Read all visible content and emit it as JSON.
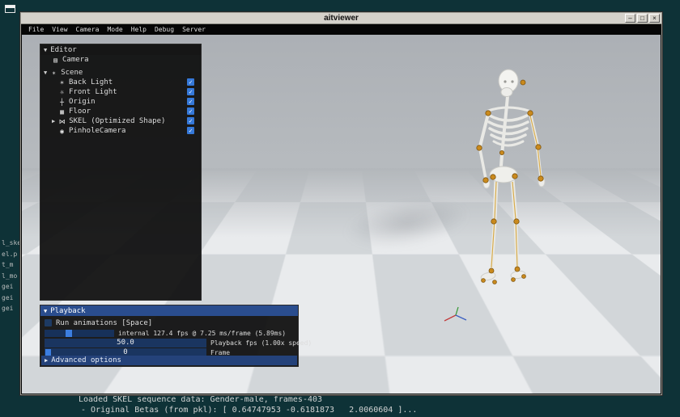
{
  "window": {
    "title": "aitviewer",
    "controls": {
      "minimize": "–",
      "maximize": "□",
      "close": "×"
    }
  },
  "menu": {
    "items": [
      "File",
      "View",
      "Camera",
      "Mode",
      "Help",
      "Debug",
      "Server"
    ]
  },
  "editor": {
    "arrow": "▼",
    "title": "Editor",
    "check_glyph": "✓",
    "items": [
      {
        "glyph": "▤",
        "label": "Camera"
      },
      {
        "arrow": "▼",
        "glyph": "∗",
        "label": "Scene"
      },
      {
        "glyph": "☀",
        "label": "Back Light",
        "checked": true
      },
      {
        "glyph": "☼",
        "label": "Front Light",
        "checked": true
      },
      {
        "glyph": "┼",
        "label": "Origin",
        "checked": true
      },
      {
        "glyph": "▦",
        "label": "Floor",
        "checked": true
      },
      {
        "arrow": "▶",
        "glyph": "⋈",
        "label": "SKEL (Optimized Shape)",
        "checked": true
      },
      {
        "glyph": "◉",
        "label": "PinholeCamera",
        "checked": true
      }
    ]
  },
  "playback": {
    "arrow": "▼",
    "title": "Playback",
    "run_label": "Run animations [Space]",
    "perf_text": "internal 127.4 fps @ 7.25 ms/frame (5.89ms)",
    "fps_value": "50.0",
    "fps_label": "Playback fps (1.00x speed)",
    "frame_value": "0",
    "frame_label": "Frame",
    "advanced_arrow": "▶",
    "advanced_label": "Advanced options"
  },
  "viewport": {
    "hint_glyph": "↓"
  },
  "terminal": {
    "line1": "Loaded SKEL sequence data: Gender-male, frames-403",
    "line2": "- Original Betas (from pkl): [ 0.64747953 -0.6181873   2.0060604 ]...",
    "fragments": [
      "l_ske",
      "el.p",
      "t_m",
      "l_mo",
      "gei",
      "gei",
      "gei"
    ]
  },
  "colors": {
    "accent": "#3c7ee0",
    "checkbox_blue": "#3578d9",
    "marker_orange": "#ca8a1d",
    "desktop": "#0e3237"
  }
}
